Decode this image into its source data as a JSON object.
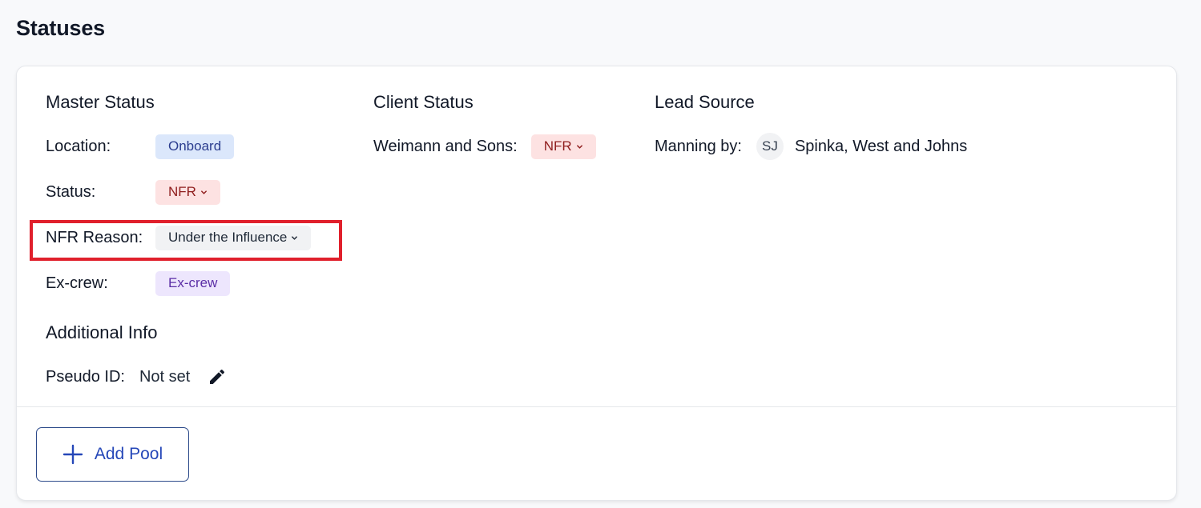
{
  "page": {
    "title": "Statuses"
  },
  "master_status": {
    "title": "Master Status",
    "location": {
      "label": "Location:",
      "value": "Onboard"
    },
    "status": {
      "label": "Status:",
      "value": "NFR"
    },
    "nfr_reason": {
      "label": "NFR Reason:",
      "value": "Under the Influence"
    },
    "ex_crew": {
      "label": "Ex-crew:",
      "value": "Ex-crew"
    }
  },
  "additional_info": {
    "title": "Additional Info",
    "pseudo_id": {
      "label": "Pseudo ID:",
      "value": "Not set"
    }
  },
  "client_status": {
    "title": "Client Status",
    "client": {
      "label": "Weimann and Sons:",
      "value": "NFR"
    }
  },
  "lead_source": {
    "title": "Lead Source",
    "manning": {
      "label": "Manning by:",
      "avatar_initials": "SJ",
      "value": "Spinka, West and Johns"
    }
  },
  "footer": {
    "add_pool_label": "Add Pool"
  },
  "colors": {
    "highlight": "#e0202c",
    "accent": "#2547b8",
    "badge_blue_bg": "#dbe7fb",
    "badge_red_bg": "#fde2e2",
    "badge_gray_bg": "#f1f2f4",
    "badge_purple_bg": "#ede6fd"
  }
}
